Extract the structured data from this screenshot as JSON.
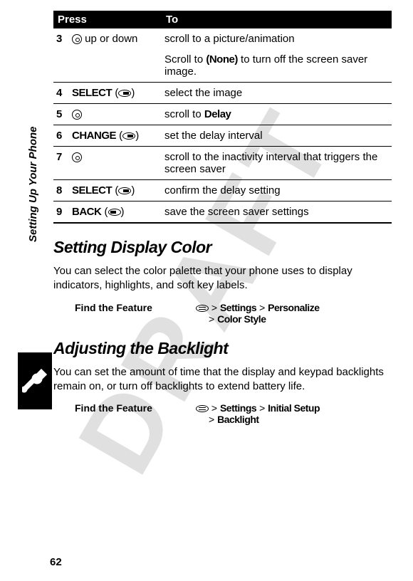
{
  "watermark": "DRAFT",
  "sidebar_label": "Setting Up Your Phone",
  "page_number": "62",
  "table": {
    "header_press": "Press",
    "header_to": "To",
    "rows": {
      "r3": {
        "num": "3",
        "press_suffix": " up or down",
        "to_line1": "scroll to a picture/animation",
        "to_line2_a": "Scroll to ",
        "to_line2_b": "(None)",
        "to_line2_c": " to turn off the screen saver image."
      },
      "r4": {
        "num": "4",
        "press_cmd": "SELECT",
        "to": "select the image"
      },
      "r5": {
        "num": "5",
        "to_a": "scroll to ",
        "to_b": "Delay"
      },
      "r6": {
        "num": "6",
        "press_cmd": "CHANGE",
        "to": "set the delay interval"
      },
      "r7": {
        "num": "7",
        "to": "scroll to the inactivity interval that triggers the screen saver"
      },
      "r8": {
        "num": "8",
        "press_cmd": "SELECT",
        "to": "confirm the delay setting"
      },
      "r9": {
        "num": "9",
        "press_cmd": "BACK",
        "to": "save the screen saver settings"
      }
    }
  },
  "section1": {
    "title": "Setting Display Color",
    "body": "You can select the color palette that your phone uses to display indicators, highlights, and soft key labels.",
    "feature_label": "Find the Feature",
    "path_a": " > ",
    "path_b": "Settings",
    "path_c": " > ",
    "path_d": "Personalize",
    "path_e": "> ",
    "path_f": "Color Style"
  },
  "section2": {
    "title": "Adjusting the Backlight",
    "body": "You can set the amount of time that the display and keypad backlights remain on, or turn off backlights to extend battery life.",
    "feature_label": "Find the Feature",
    "path_a": " > ",
    "path_b": "Settings",
    "path_c": " > ",
    "path_d": "Initial Setup",
    "path_e": "> ",
    "path_f": "Backlight"
  }
}
